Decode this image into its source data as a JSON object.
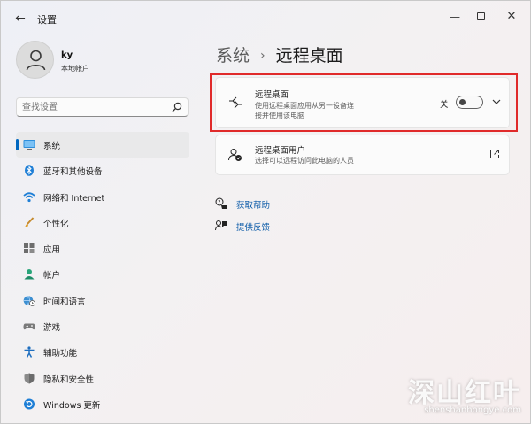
{
  "window": {
    "title": "设置",
    "back_icon": "back-arrow-icon"
  },
  "user": {
    "name": "ky",
    "account_type": "本地帐户"
  },
  "search": {
    "placeholder": "查找设置"
  },
  "sidebar": {
    "items": [
      {
        "label": "系统",
        "icon": "system-icon",
        "active": true
      },
      {
        "label": "蓝牙和其他设备",
        "icon": "bluetooth-icon"
      },
      {
        "label": "网络和 Internet",
        "icon": "wifi-icon"
      },
      {
        "label": "个性化",
        "icon": "brush-icon"
      },
      {
        "label": "应用",
        "icon": "apps-icon"
      },
      {
        "label": "帐户",
        "icon": "account-icon"
      },
      {
        "label": "时间和语言",
        "icon": "globe-clock-icon"
      },
      {
        "label": "游戏",
        "icon": "gamepad-icon"
      },
      {
        "label": "辅助功能",
        "icon": "accessibility-icon"
      },
      {
        "label": "隐私和安全性",
        "icon": "shield-icon"
      },
      {
        "label": "Windows 更新",
        "icon": "update-icon"
      }
    ]
  },
  "breadcrumb": {
    "parent": "系统",
    "separator": "›",
    "current": "远程桌面"
  },
  "remote_desktop_card": {
    "title": "远程桌面",
    "description_line1": "使用远程桌面应用从另一设备连",
    "description_line2": "接并使用该电脑",
    "toggle_state_label": "关",
    "toggle_on": false
  },
  "remote_users_card": {
    "title": "远程桌面用户",
    "description": "选择可以远程访问此电脑的人员"
  },
  "links": {
    "get_help": "获取帮助",
    "give_feedback": "提供反馈"
  },
  "watermark": {
    "brand": "深山红叶",
    "url": "shenshanhongye.com"
  },
  "colors": {
    "accent": "#0067c0",
    "link": "#0a5aa8",
    "highlight_box": "#e02a2a"
  }
}
